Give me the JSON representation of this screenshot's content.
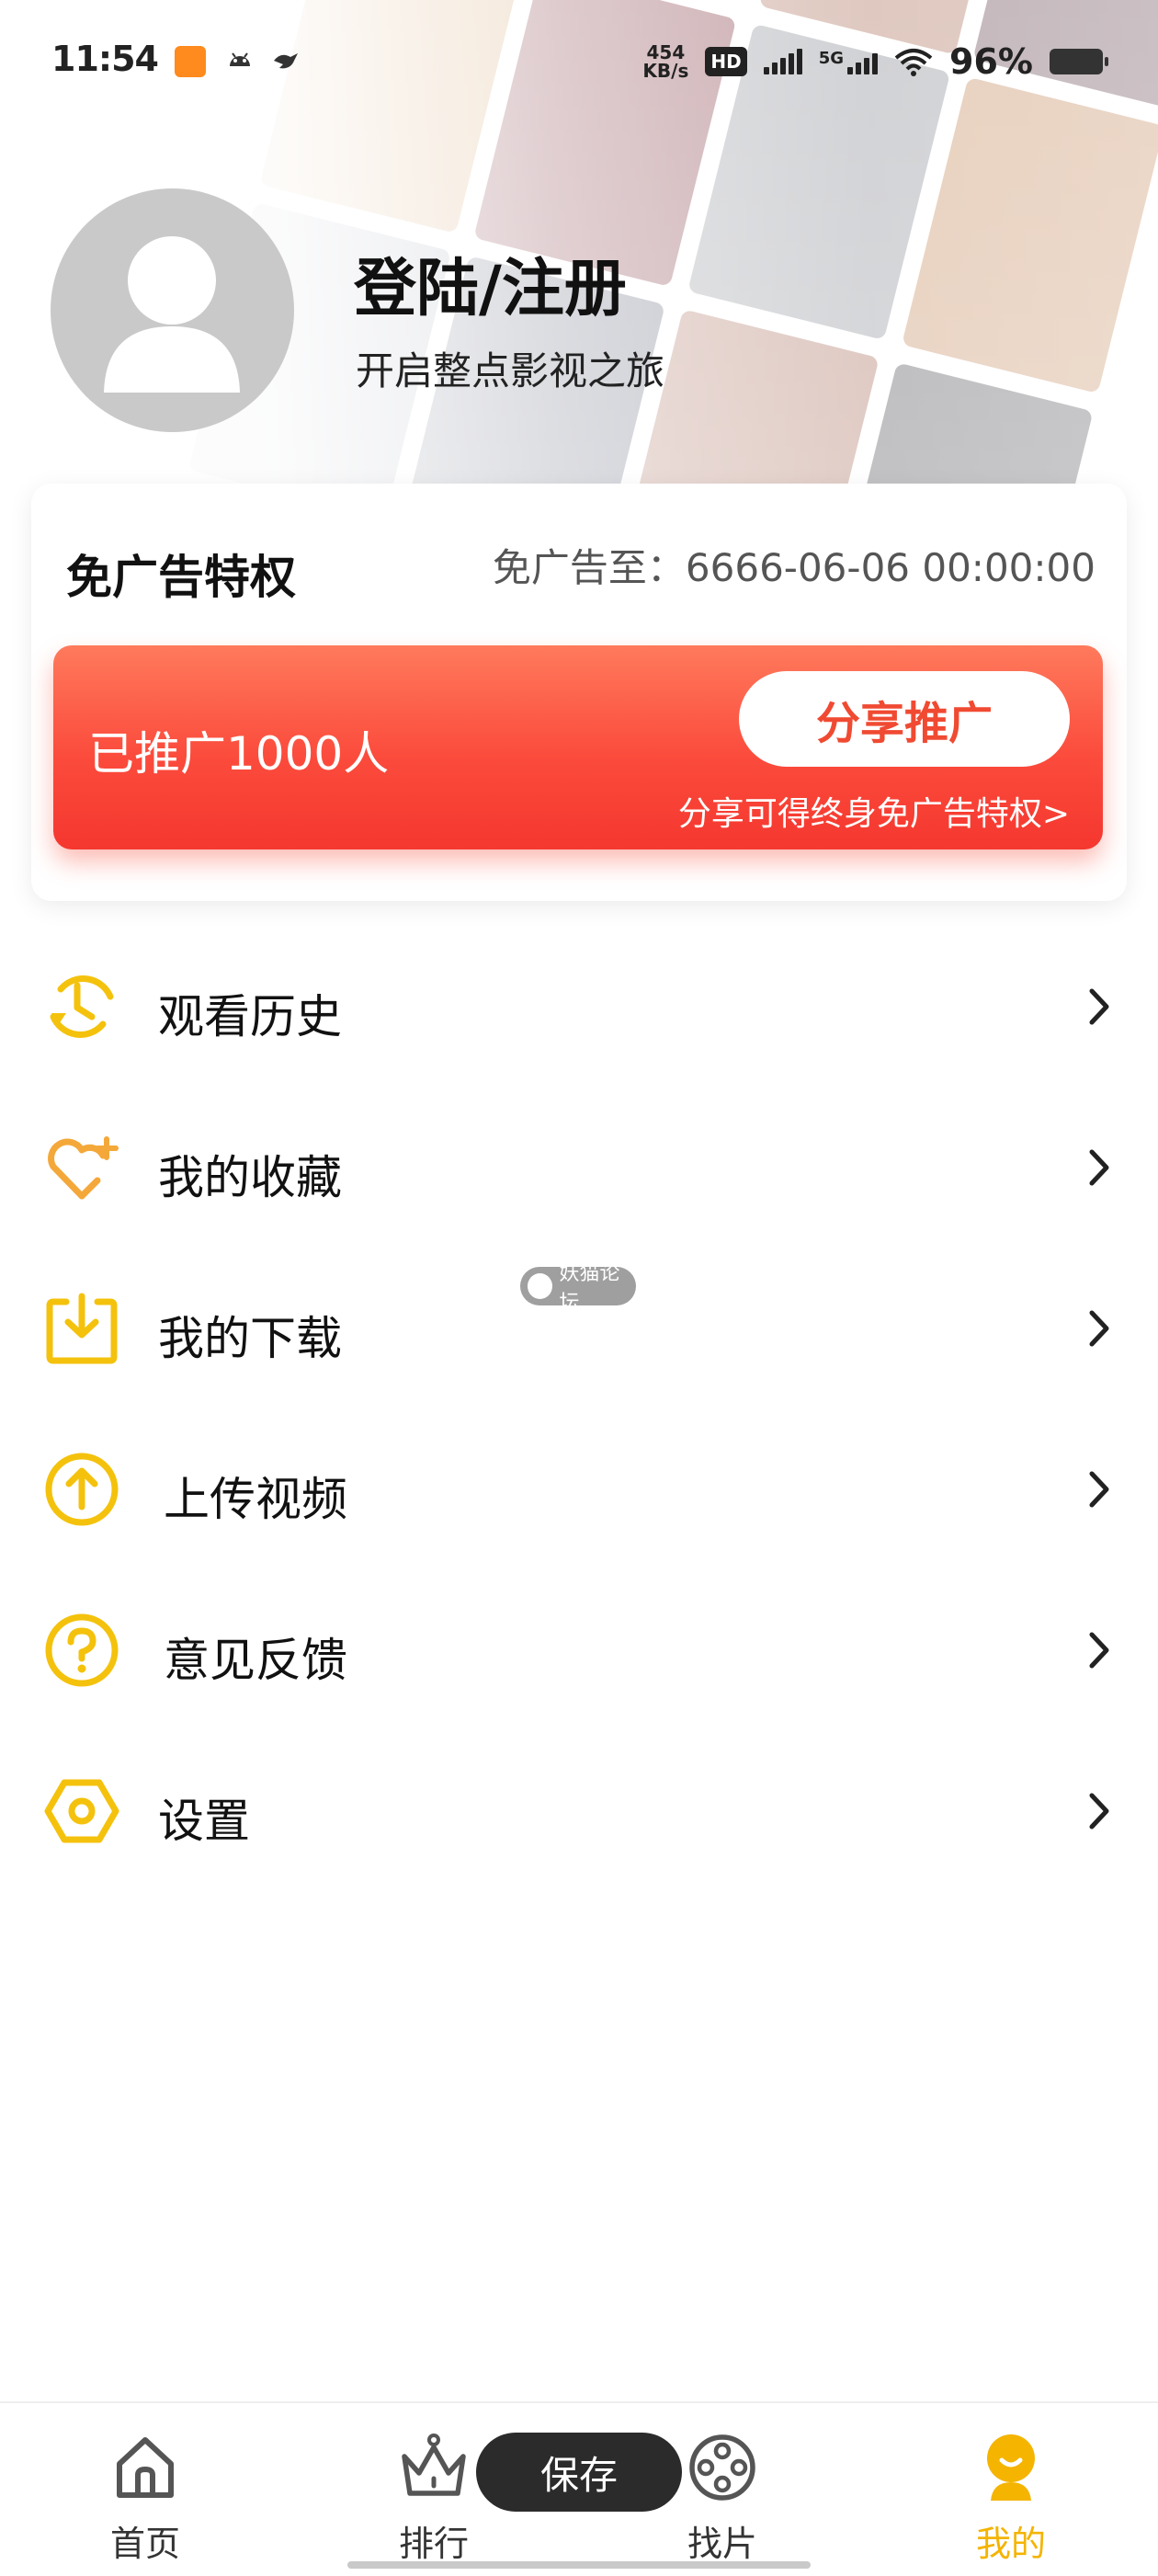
{
  "status_bar": {
    "time": "11:54",
    "net_speed_value": "454",
    "net_speed_unit": "KB/s",
    "hd_label": "HD",
    "network_5g": "5G",
    "battery": "96%"
  },
  "profile": {
    "login_title": "登陆/注册",
    "subtitle": "开启整点影视之旅"
  },
  "adfree": {
    "title": "免广告特权",
    "until": "免广告至：6666-06-06 00:00:00",
    "promoted_count": "已推广1000人",
    "share_button": "分享推广",
    "share_note": "分享可得终身免广告特权>"
  },
  "menu": [
    {
      "label": "观看历史",
      "icon": "history-icon"
    },
    {
      "label": "我的收藏",
      "icon": "favorite-heart-icon"
    },
    {
      "label": "我的下载",
      "icon": "download-icon"
    },
    {
      "label": "上传视频",
      "icon": "upload-icon"
    },
    {
      "label": "意见反馈",
      "icon": "question-icon"
    },
    {
      "label": "设置",
      "icon": "settings-hexagon-icon"
    }
  ],
  "watermark": "妖猫论坛",
  "save_toast": "保存",
  "bottom_nav": [
    {
      "label": "首页",
      "icon": "home-icon",
      "active": false
    },
    {
      "label": "排行",
      "icon": "crown-icon",
      "active": false
    },
    {
      "label": "找片",
      "icon": "film-reel-icon",
      "active": false
    },
    {
      "label": "我的",
      "icon": "profile-icon",
      "active": true
    }
  ],
  "colors": {
    "accent_yellow": "#f4c20d",
    "promo_red": "#f5372f",
    "active_nav": "#f4b400"
  }
}
